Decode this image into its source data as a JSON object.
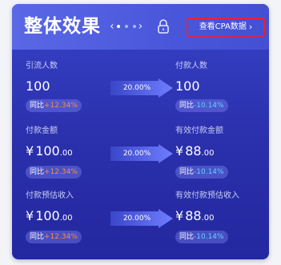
{
  "header": {
    "title": "整体效果",
    "cpa_link": "查看CPA数据"
  },
  "colors": {
    "card_bg": "#2a2fab",
    "header_bg": "#4a57db",
    "highlight_border": "#e8203a",
    "increase": "#ff8a3d",
    "decrease": "#5fd2ff"
  },
  "rows": [
    {
      "left": {
        "label": "引流人数",
        "value": "100",
        "yoy_prefix": "同比",
        "yoy_change": "+12.34%"
      },
      "rate": "20.00%",
      "right": {
        "label": "付款人数",
        "value": "100",
        "yoy_prefix": "同比",
        "yoy_change": "-10.14%"
      }
    },
    {
      "left": {
        "label": "付款金额",
        "currency": "¥",
        "integer": "100",
        "decimal": ".00",
        "yoy_prefix": "同比",
        "yoy_change": "+12.34%"
      },
      "rate": "20.00%",
      "right": {
        "label": "有效付款金额",
        "currency": "¥",
        "integer": "88",
        "decimal": ".00",
        "yoy_prefix": "同比",
        "yoy_change": "-10.14%"
      }
    },
    {
      "left": {
        "label": "付款预估收入",
        "currency": "¥",
        "integer": "100",
        "decimal": ".00",
        "yoy_prefix": "同比",
        "yoy_change": "+12.34%"
      },
      "rate": "20.00%",
      "right": {
        "label": "有效付款预估收入",
        "currency": "¥",
        "integer": "88",
        "decimal": ".00",
        "yoy_prefix": "同比",
        "yoy_change": "-10.14%"
      }
    }
  ]
}
